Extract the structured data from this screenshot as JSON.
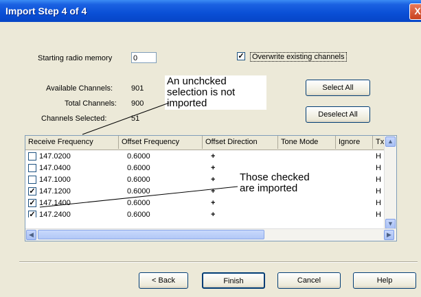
{
  "window": {
    "title": "Import Step 4 of 4",
    "close_glyph": "X"
  },
  "form": {
    "starting_memory_label": "Starting radio memory",
    "starting_memory_value": "0",
    "overwrite_label": "Overwrite existing channels",
    "overwrite_checked": true
  },
  "stats": {
    "available_label": "Available Channels:",
    "available_value": "901",
    "total_label": "Total Channels:",
    "total_value": "900",
    "selected_label": "Channels Selected:",
    "selected_value": "51"
  },
  "buttons": {
    "select_all": "Select All",
    "deselect_all": "Deselect All",
    "back": "< Back",
    "finish": "Finish",
    "cancel": "Cancel",
    "help": "Help"
  },
  "annotations": {
    "unchecked_note": [
      "An unchcked",
      "selection is not",
      "imported"
    ],
    "checked_note": [
      "Those checked",
      "are imported"
    ]
  },
  "table": {
    "columns": [
      "Receive Frequency",
      "Offset Frequency",
      "Offset Direction",
      "Tone Mode",
      "Ignore",
      "Tx Power"
    ],
    "rows": [
      {
        "checked": false,
        "receive": "147.0200",
        "offset": "0.6000",
        "direction": "+",
        "tx": "H"
      },
      {
        "checked": false,
        "receive": "147.0400",
        "offset": "0.6000",
        "direction": "+",
        "tx": "H"
      },
      {
        "checked": false,
        "receive": "147.1000",
        "offset": "0.6000",
        "direction": "+",
        "tx": "H"
      },
      {
        "checked": true,
        "receive": "147.1200",
        "offset": "0.6000",
        "direction": "+",
        "tx": "H"
      },
      {
        "checked": true,
        "receive": "147.1400",
        "offset": "0.6000",
        "direction": "+",
        "tx": "H"
      },
      {
        "checked": true,
        "receive": "147.2400",
        "offset": "0.6000",
        "direction": "+",
        "tx": "H"
      }
    ]
  },
  "colors": {
    "titlebar": "#0a4fd6",
    "dialog_bg": "#ece9d8",
    "scroll_thumb": "#b9cdf8"
  }
}
